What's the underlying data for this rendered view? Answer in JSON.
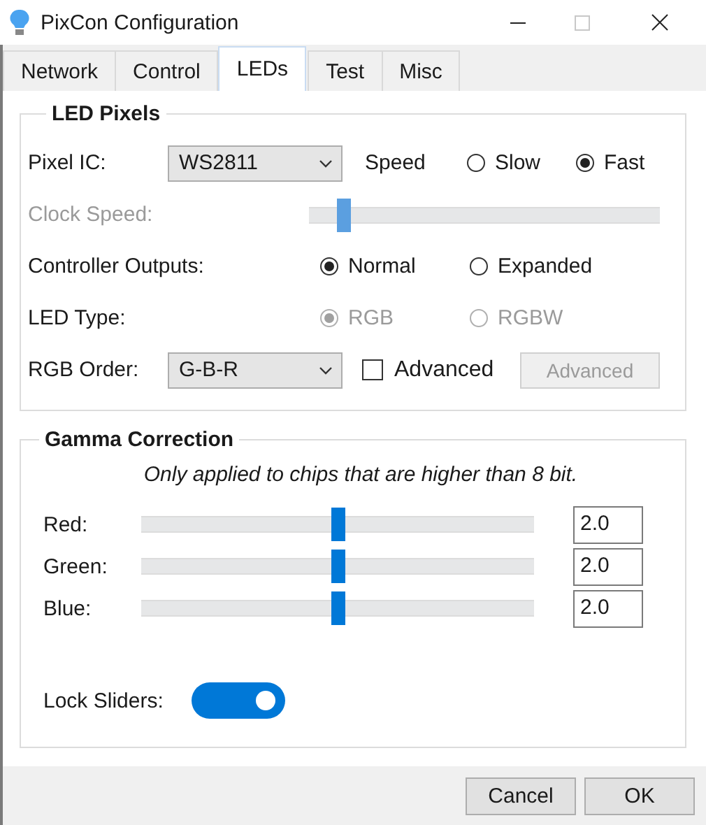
{
  "window": {
    "title": "PixCon Configuration"
  },
  "tabs": [
    {
      "label": "Network",
      "selected": false
    },
    {
      "label": "Control",
      "selected": false
    },
    {
      "label": "LEDs",
      "selected": true
    },
    {
      "label": "Test",
      "selected": false
    },
    {
      "label": "Misc",
      "selected": false
    }
  ],
  "led_pixels": {
    "title": "LED Pixels",
    "pixel_ic": {
      "label": "Pixel IC:",
      "value": "WS2811"
    },
    "speed": {
      "label": "Speed",
      "options": [
        {
          "label": "Slow",
          "selected": false
        },
        {
          "label": "Fast",
          "selected": true
        }
      ]
    },
    "clock_speed": {
      "label": "Clock Speed:",
      "disabled": true,
      "level": 0.1
    },
    "controller_outputs": {
      "label": "Controller Outputs:",
      "disabled": false,
      "options": [
        {
          "label": "Normal",
          "selected": true
        },
        {
          "label": "Expanded",
          "selected": false
        }
      ]
    },
    "led_type": {
      "label": "LED Type:",
      "disabled": true,
      "options": [
        {
          "label": "RGB",
          "selected": true
        },
        {
          "label": "RGBW",
          "selected": false
        }
      ]
    },
    "rgb_order": {
      "label": "RGB Order:",
      "value": "G-B-R"
    },
    "advanced_checkbox": {
      "label": "Advanced",
      "checked": false
    },
    "advanced_button": {
      "label": "Advanced",
      "disabled": true
    }
  },
  "gamma": {
    "title": "Gamma Correction",
    "note": "Only applied to chips that are higher than 8 bit.",
    "channels": [
      {
        "name": "Red:",
        "level": 0.5,
        "value": "2.0"
      },
      {
        "name": "Green:",
        "level": 0.5,
        "value": "2.0"
      },
      {
        "name": "Blue:",
        "level": 0.5,
        "value": "2.0"
      }
    ],
    "lock_sliders": {
      "label": "Lock Sliders:",
      "on": true
    }
  },
  "buttons": [
    {
      "label": "Cancel"
    },
    {
      "label": "OK"
    }
  ]
}
